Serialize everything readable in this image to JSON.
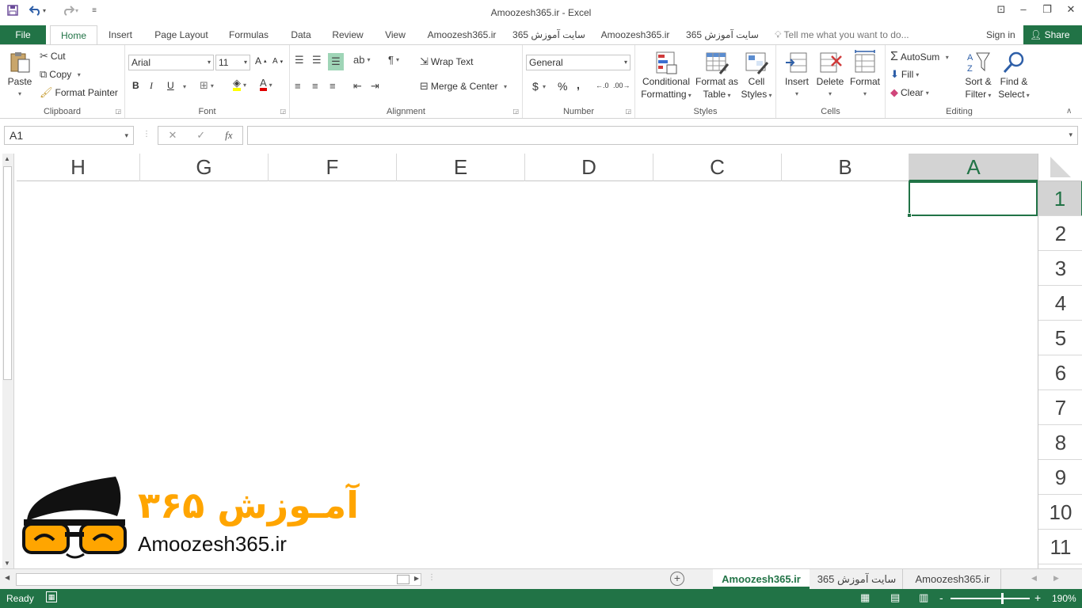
{
  "window": {
    "title": "Amoozesh365.ir - Excel",
    "controls": [
      "ribbon-display",
      "minimize",
      "restore",
      "close"
    ]
  },
  "qat": {
    "save": "save-icon",
    "undo": "undo-icon",
    "redo": "redo-icon",
    "customize": "customize-icon"
  },
  "tabs": {
    "file": "File",
    "items": [
      "Home",
      "Insert",
      "Page Layout",
      "Formulas",
      "Data",
      "Review",
      "View",
      "Amoozesh365.ir",
      "سایت آموزش 365",
      "Amoozesh365.ir",
      "سایت آموزش 365"
    ],
    "active": "Home",
    "tellme": "Tell me what you want to do...",
    "signin": "Sign in",
    "share": "Share"
  },
  "ribbon": {
    "clipboard": {
      "label": "Clipboard",
      "paste": "Paste",
      "cut": "Cut",
      "copy": "Copy",
      "format_painter": "Format Painter"
    },
    "font": {
      "label": "Font",
      "name": "Arial",
      "size": "11",
      "bold": "B",
      "italic": "I",
      "underline": "U"
    },
    "alignment": {
      "label": "Alignment",
      "wrap": "Wrap Text",
      "merge": "Merge & Center"
    },
    "number": {
      "label": "Number",
      "format": "General",
      "currency": "$",
      "percent": "%",
      "comma": ","
    },
    "styles": {
      "label": "Styles",
      "conditional_1": "Conditional",
      "conditional_2": "Formatting",
      "format_table_1": "Format as",
      "format_table_2": "Table",
      "cell_styles_1": "Cell",
      "cell_styles_2": "Styles"
    },
    "cells": {
      "label": "Cells",
      "insert": "Insert",
      "delete": "Delete",
      "format": "Format"
    },
    "editing": {
      "label": "Editing",
      "autosum": "AutoSum",
      "fill": "Fill",
      "clear": "Clear",
      "sort_1": "Sort &",
      "sort_2": "Filter",
      "find_1": "Find &",
      "find_2": "Select"
    }
  },
  "formula_bar": {
    "name_box": "A1",
    "fx": "fx",
    "cancel": "✕",
    "enter": "✓",
    "content": ""
  },
  "grid": {
    "columns": [
      "H",
      "G",
      "F",
      "E",
      "D",
      "C",
      "B",
      "A"
    ],
    "rows": [
      "1",
      "2",
      "3",
      "4",
      "5",
      "6",
      "7",
      "8",
      "9",
      "10",
      "11"
    ],
    "selected_column": "A",
    "selected_row": "1",
    "direction": "rtl"
  },
  "logo": {
    "persian_text": "آمـوزش ۳۶۵",
    "latin_text": "Amoozesh365.ir"
  },
  "sheets": {
    "tabs": [
      "Amoozesh365.ir",
      "سایت آموزش 365",
      "Amoozesh365.ir"
    ],
    "active": "Amoozesh365.ir",
    "add": "+"
  },
  "status": {
    "ready": "Ready",
    "zoom": "190%",
    "zoom_minus": "-",
    "zoom_plus": "+"
  },
  "colors": {
    "accent": "#217346",
    "logo_orange": "#FFA500",
    "logo_black": "#111111"
  }
}
